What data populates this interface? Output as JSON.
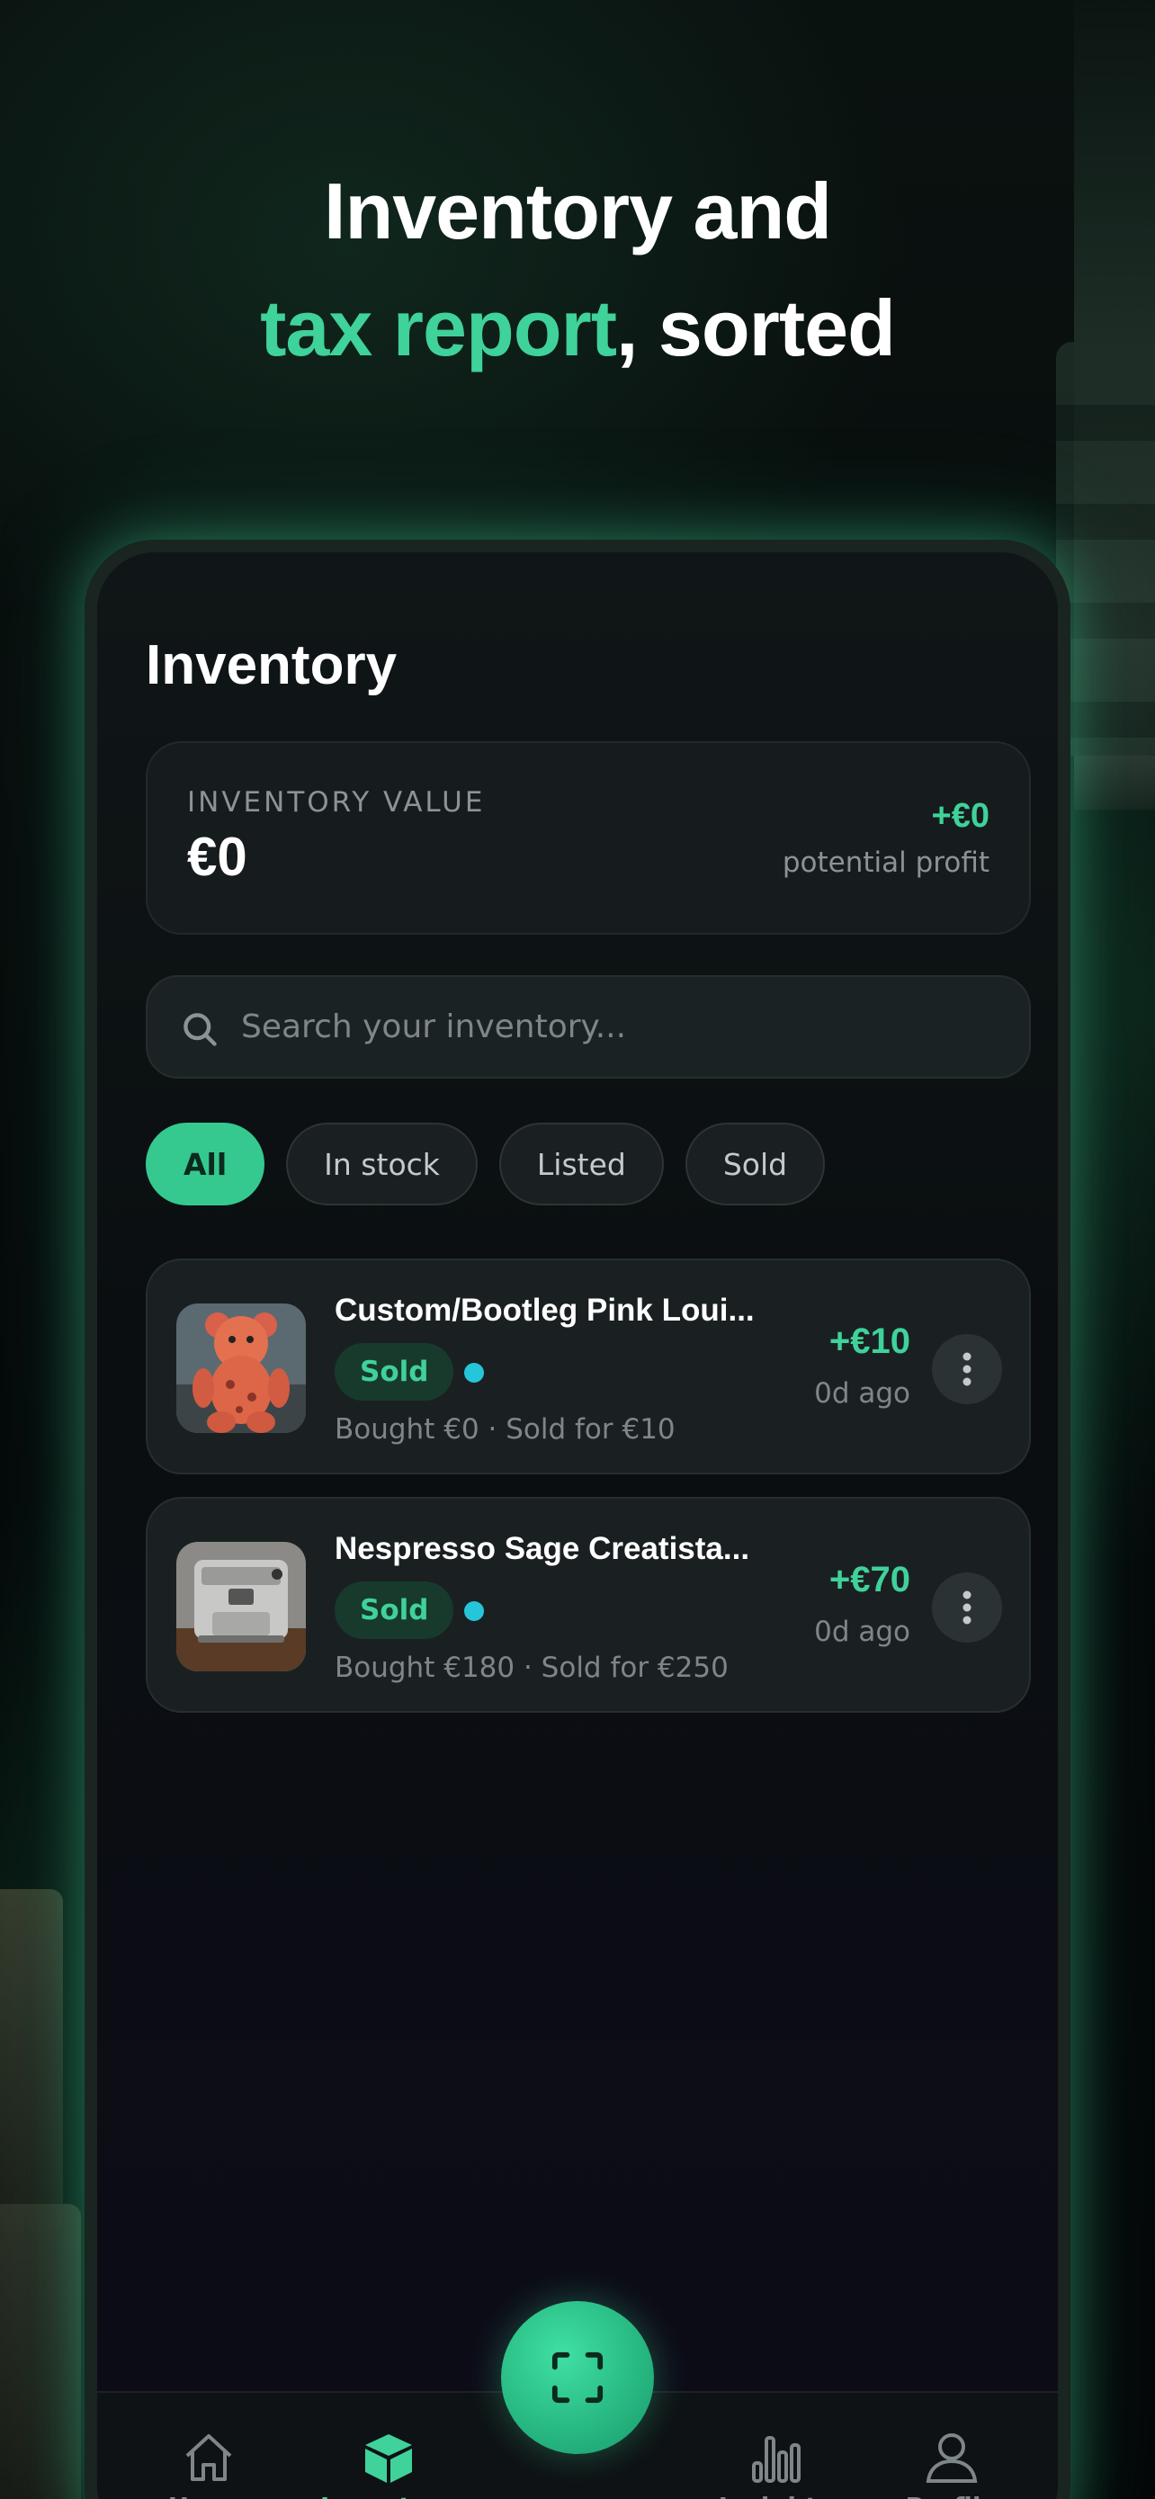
{
  "hero": {
    "line1": "Inventory and",
    "line2_accent": "tax report",
    "line2_rest": ", sorted"
  },
  "screen": {
    "title": "Inventory",
    "summary": {
      "label": "INVENTORY VALUE",
      "value": "€0",
      "profit": "+€0",
      "profit_label": "potential profit"
    },
    "search": {
      "placeholder": "Search your inventory..."
    },
    "filters": [
      {
        "label": "All",
        "active": true
      },
      {
        "label": "In stock",
        "active": false
      },
      {
        "label": "Listed",
        "active": false
      },
      {
        "label": "Sold",
        "active": false
      }
    ],
    "items": [
      {
        "name": "Custom/Bootleg Pink Loui...",
        "status": "Sold",
        "meta": "Bought €0 · Sold for €10",
        "profit": "+€10",
        "age": "0d ago",
        "thumb": "teddy-bear-photo"
      },
      {
        "name": "Nespresso Sage Creatista...",
        "status": "Sold",
        "meta": "Bought €180 · Sold for €250",
        "profit": "+€70",
        "age": "0d ago",
        "thumb": "espresso-machine-photo"
      }
    ],
    "nav": {
      "home": "Home",
      "inventory": "Inventory",
      "insights": "Insights",
      "profile": "Profile"
    }
  },
  "colors": {
    "accent": "#3fd29a",
    "status_dot": "#26c6da"
  }
}
